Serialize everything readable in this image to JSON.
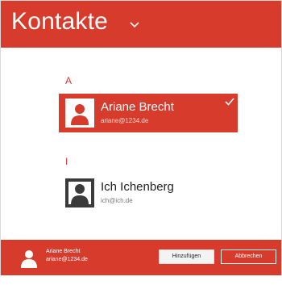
{
  "header": {
    "title": "Kontakte",
    "dropdown_icon": "chevron-down-icon"
  },
  "sections": [
    {
      "letter": "A",
      "contacts": [
        {
          "name": "Ariane Brecht",
          "email": "ariane@1234.de",
          "selected": true
        }
      ]
    },
    {
      "letter": "I",
      "contacts": [
        {
          "name": "Ich Ichenberg",
          "email": "ich@ich.de",
          "selected": false
        }
      ]
    }
  ],
  "footer": {
    "selected_name": "Ariane Brecht",
    "selected_email": "ariane@1234.de",
    "add_button": "Hinzufügen",
    "cancel_button": "Abbrechen"
  },
  "colors": {
    "accent": "#d63b2c",
    "background": "#ffffff"
  }
}
